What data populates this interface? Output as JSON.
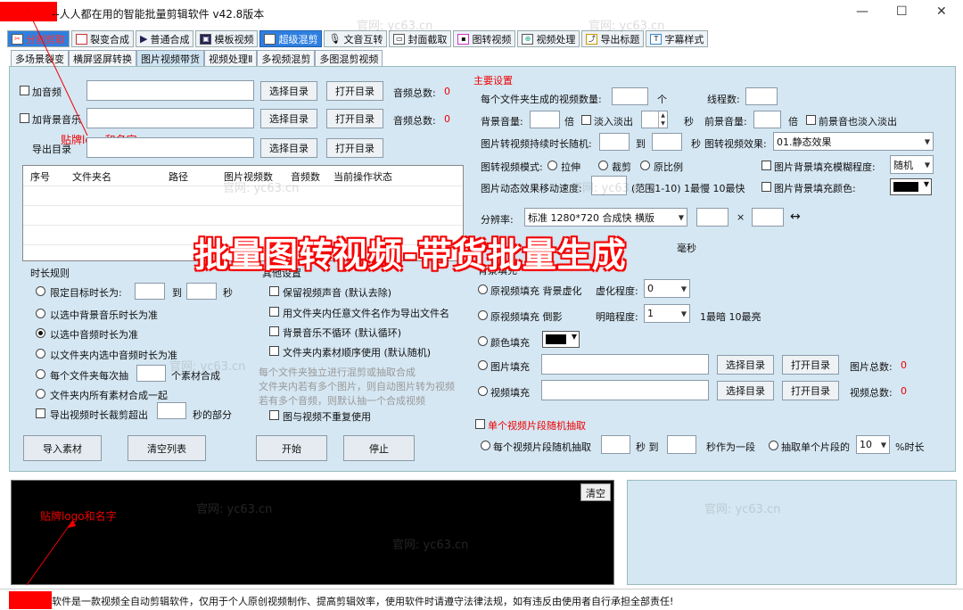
{
  "window": {
    "title": "--人人都在用的智能批量剪辑软件  v42.8版本",
    "minimize": "—",
    "maximize": "☐",
    "close": "✕"
  },
  "main_tabs": [
    {
      "label": "分割剪取",
      "icon": "scissors-icon"
    },
    {
      "label": "裂变合成",
      "icon": "merge-icon"
    },
    {
      "label": "普通合成",
      "icon": "play-icon"
    },
    {
      "label": "模板视频",
      "icon": "book-icon"
    },
    {
      "label": "超级混剪",
      "icon": "mix-icon"
    },
    {
      "label": "文音互转",
      "icon": "mic-icon"
    },
    {
      "label": "封面截取",
      "icon": "image-icon"
    },
    {
      "label": "图转视频",
      "icon": "picture-icon"
    },
    {
      "label": "视频处理",
      "icon": "video-icon"
    },
    {
      "label": "导出标题",
      "icon": "export-icon"
    },
    {
      "label": "字幕样式",
      "icon": "subtitle-icon"
    }
  ],
  "sub_tabs": [
    "多场景裂变",
    "横屏竖屏转换",
    "图片视频带货",
    "视频处理Ⅱ",
    "多视频混剪",
    "多图混剪视频"
  ],
  "left": {
    "add_audio": "加音频",
    "add_bgm": "加背景音乐",
    "export_dir": "导出目录",
    "select_dir": "选择目录",
    "open_dir": "打开目录",
    "audio_total": "音频总数:",
    "bgm_total": "音频总数:",
    "zero": "0",
    "sticker_note": "贴牌logo和名字",
    "table_headers": [
      "序号",
      "文件夹名",
      "路径",
      "图片视频数",
      "音频数",
      "当前操作状态"
    ]
  },
  "duration": {
    "title": "时长规则",
    "opt1": "限定目标时长为:",
    "to": "到",
    "sec": "秒",
    "opt2": "以选中背景音乐时长为准",
    "opt3": "以选中音频时长为准",
    "opt4": "以文件夹内选中音频时长为准",
    "opt5a": "每个文件夹每次抽",
    "opt5b": "个素材合成",
    "opt6": "文件夹内所有素材合成一起",
    "opt7a": "导出视频时长裁剪超出",
    "opt7b": "秒的部分"
  },
  "other": {
    "title": "其他设置",
    "c1": "保留视频声音 (默认去除)",
    "c2": "用文件夹内任意文件名作为导出文件名",
    "c3": "背景音乐不循环 (默认循环)",
    "c4": "文件夹内素材顺序使用 (默认随机)",
    "desc1": "每个文件夹独立进行混剪或抽取合成",
    "desc2": "文件夹内若有多个图片，则自动图片转为视频",
    "desc3": "若有多个音频，则默认抽一个合成视频",
    "c5": "图与视频不重复使用"
  },
  "actions": {
    "import": "导入素材",
    "clear_list": "清空列表",
    "start": "开始",
    "stop": "停止"
  },
  "main_settings": {
    "title": "主要设置",
    "per_folder": "每个文件夹生成的视频数量:",
    "unit": "个",
    "threads": "线程数:",
    "bg_vol": "背景音量:",
    "times": "倍",
    "fade": "淡入淡出",
    "sec": "秒",
    "fg_vol": "前景音量:",
    "times2": "倍",
    "fg_fade": "前景音也淡入淡出",
    "img_dur": "图片转视频持续时长随机:",
    "to": "到",
    "sec2": "秒",
    "img_effect": "图转视频效果:",
    "img_effect_val": "01.静态效果",
    "mode": "图转视频模式:",
    "stretch": "拉伸",
    "crop": "裁剪",
    "ratio": "原比例",
    "blur_fill": "图片背景填充模糊程度:",
    "blur_val": "随机",
    "motion": "图片动态效果移动速度:",
    "motion_range": "(范围1-10)  1最慢 10最快",
    "bg_color": "图片背景填充颜色:",
    "res": "分辨率:",
    "res_val": "标准 1280*720 合成快 横版",
    "x": "×",
    "swap": "↔",
    "ms": "毫秒"
  },
  "fill": {
    "label": "背景填充",
    "o1": "原视频填充 背景虚化",
    "blur_deg": "虚化程度:",
    "blur_deg_val": "0",
    "o2": "原视频填充 倒影",
    "bright": "明暗程度:",
    "bright_val": "1",
    "bright_range": "1最暗 10最亮",
    "o3": "颜色填充",
    "o4": "图片填充",
    "img_total": "图片总数:",
    "o5": "视频填充",
    "vid_total": "视频总数:",
    "zero": "0",
    "select_dir": "选择目录",
    "open_dir": "打开目录"
  },
  "segment": {
    "title": "单个视频片段随机抽取",
    "o1": "每个视频片段随机抽取",
    "sec": "秒 到",
    "sec_as": "秒作为一段",
    "o2": "抽取单个片段的",
    "pct_val": "10",
    "pct": "%时长"
  },
  "banner": "批量图转视频-带货批量生成",
  "log": {
    "clear": "清空",
    "sticker_note": "贴牌logo和名字"
  },
  "watermark": "官网: yc63.cn",
  "status": "软件是一款视频全自动剪辑软件，仅用于个人原创视频制作、提高剪辑效率，使用软件时请遵守法律法规，如有违反由使用者自行承担全部责任!"
}
